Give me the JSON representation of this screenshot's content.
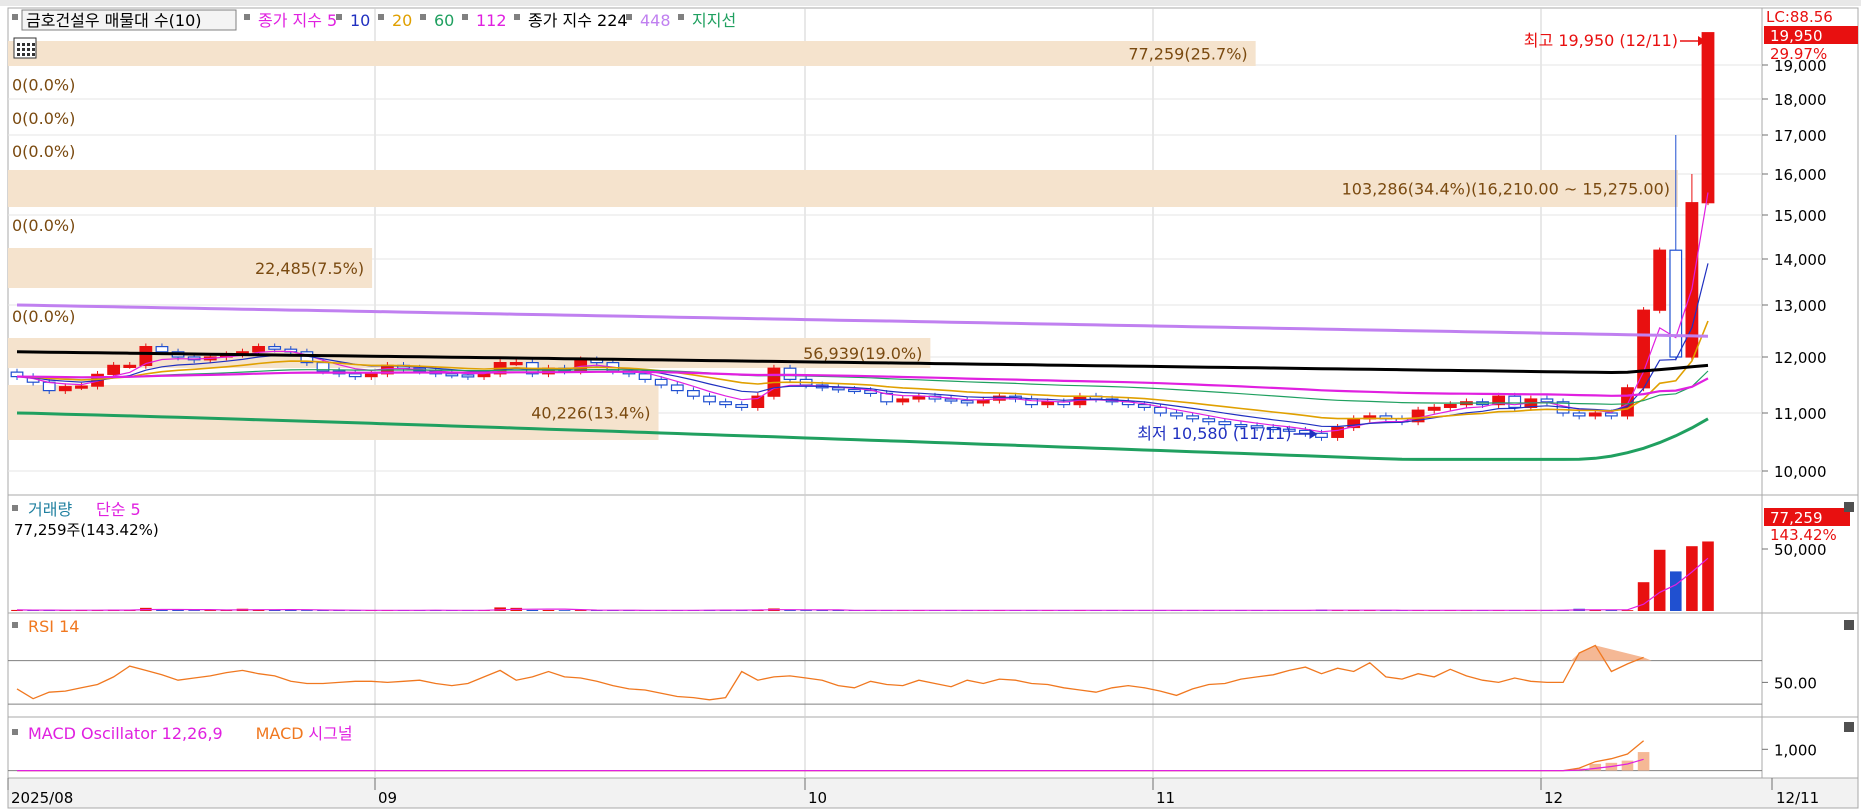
{
  "window": {
    "title": "금호건설우 매물대 수(10)"
  },
  "price_panel": {
    "legend": [
      {
        "text": "금호건설우 매물대 수(10)",
        "color": "#000000",
        "boxed": true
      },
      {
        "text": "종가 지수 5",
        "color": "#e020e0"
      },
      {
        "text": "10",
        "color": "#2030c0"
      },
      {
        "text": "20",
        "color": "#e0a000"
      },
      {
        "text": "60",
        "color": "#20a060"
      },
      {
        "text": "112",
        "color": "#e020e0"
      },
      {
        "text": "종가 지수 224",
        "color": "#000000"
      },
      {
        "text": "448",
        "color": "#c080f0"
      },
      {
        "text": "지지선",
        "color": "#20a060"
      }
    ],
    "lc_label": "LC:88.56",
    "last_price_label": "19,950",
    "last_pct_label": "29.97%",
    "high_label": "최고 19,950 (12/11)",
    "low_label": "최저 10,580 (11/11)",
    "price_ticks": [
      "10,000",
      "11,000",
      "12,000",
      "13,000",
      "14,000",
      "15,000",
      "16,000",
      "17,000",
      "18,000",
      "19,000"
    ]
  },
  "volume_panel": {
    "legend": [
      {
        "text": "거래량",
        "color": "#2080a0"
      },
      {
        "text": "단순 5",
        "color": "#e020e0"
      }
    ],
    "value_label": "77,259주(143.42%)",
    "last_value_box": "77,259",
    "last_pct_box": "143.42%",
    "ticks": [
      "50,000"
    ]
  },
  "rsi_panel": {
    "legend": [
      {
        "text": "RSI 14",
        "color": "#f07820"
      }
    ],
    "ticks": [
      "50.00"
    ]
  },
  "macd_panel": {
    "legend": [
      {
        "text": "MACD Oscillator 12,26,9",
        "color": "#e020e0"
      },
      {
        "text": "MACD",
        "color": "#f07820"
      },
      {
        "text": "시그널",
        "color": "#e020e0"
      }
    ],
    "ticks": [
      "1,000"
    ]
  },
  "x_axis": {
    "labels": [
      "2025/08",
      "09",
      "10",
      "11",
      "12"
    ],
    "right_label": "12/11"
  },
  "colors": {
    "up": "#e81010",
    "down": "#2050d0",
    "vp": "#f5e3cd",
    "vp_text": "#7a4a10",
    "grid": "#d0d0d0"
  },
  "chart_data": [
    {
      "type": "candlestick",
      "ylim": [
        9700,
        20100
      ],
      "close": [
        11650,
        11550,
        11400,
        11470,
        11480,
        11690,
        11850,
        11850,
        12200,
        12100,
        12000,
        11950,
        12000,
        12050,
        12100,
        12200,
        12150,
        12100,
        11900,
        11750,
        11700,
        11650,
        11700,
        11850,
        11800,
        11750,
        11700,
        11680,
        11650,
        11700,
        11900,
        11900,
        11700,
        11800,
        11750,
        11950,
        11900,
        11750,
        11700,
        11600,
        11500,
        11400,
        11300,
        11200,
        11150,
        11100,
        11300,
        11800,
        11600,
        11500,
        11450,
        11420,
        11400,
        11350,
        11200,
        11250,
        11300,
        11250,
        11220,
        11180,
        11230,
        11300,
        11250,
        11150,
        11200,
        11150,
        11300,
        11250,
        11200,
        11150,
        11100,
        11000,
        10950,
        10900,
        10850,
        10800,
        10780,
        10750,
        10720,
        10700,
        10650,
        10580,
        10750,
        10900,
        10950,
        10900,
        10850,
        11050,
        11100,
        11150,
        11200,
        11150,
        11300,
        11100,
        11250,
        11200,
        11000,
        10950,
        11000,
        10950,
        11450,
        12900,
        14200,
        12000,
        15300,
        19950
      ],
      "volume_pct_labels": []
    },
    {
      "type": "volume_profile",
      "bands": [
        {
          "lo": 19600,
          "hi": 20100,
          "label": "77,259(25.7%)",
          "share": 0.257
        },
        {
          "lo": 19000,
          "hi": 19600,
          "label": "0(0.0%)",
          "share": 0
        },
        {
          "lo": 18300,
          "hi": 19000,
          "label": "0(0.0%)",
          "share": 0
        },
        {
          "lo": 17600,
          "hi": 18300,
          "label": "0(0.0%)",
          "share": 0
        },
        {
          "lo": 15275,
          "hi": 16210,
          "label": "103,286(34.4%)(16,210.00 ~ 15,275.00)",
          "share": 0.344
        },
        {
          "lo": 14500,
          "hi": 15275,
          "label": "0(0.0%)",
          "share": 0
        },
        {
          "lo": 13300,
          "hi": 14400,
          "label": "22,485(7.5%)",
          "share": 0.075
        },
        {
          "lo": 12700,
          "hi": 13300,
          "label": "0(0.0%)",
          "share": 0
        },
        {
          "lo": 11800,
          "hi": 12400,
          "label": "56,939(19.0%)",
          "share": 0.19
        },
        {
          "lo": 10600,
          "hi": 11700,
          "label": "40,226(13.4%)",
          "share": 0.134
        }
      ]
    },
    {
      "type": "line",
      "series": [
        {
          "key": "ema224",
          "color": "#000000",
          "width": 3,
          "values": [
            12100,
            11700,
            11850
          ]
        },
        {
          "key": "ema448",
          "color": "#c080f0",
          "width": 3,
          "values": [
            13000,
            12600,
            12400
          ]
        },
        {
          "key": "support",
          "color": "#20a060",
          "width": 3,
          "values": [
            11000,
            10200,
            10900
          ]
        }
      ]
    },
    {
      "type": "bar",
      "name": "거래량",
      "ylim": [
        0,
        90000
      ],
      "values": [
        1200,
        900,
        800,
        700,
        900,
        1100,
        1500,
        1000,
        3500,
        1200,
        1100,
        900,
        1000,
        1300,
        2500,
        1400,
        1200,
        1100,
        900,
        900,
        800,
        700,
        800,
        900,
        900,
        800,
        800,
        700,
        700,
        700,
        4000,
        3500,
        1200,
        1100,
        900,
        1000,
        900,
        800,
        700,
        700,
        900,
        700,
        800,
        1200,
        1300,
        1100,
        900,
        2800,
        1000,
        800,
        800,
        700,
        700,
        800,
        900,
        700,
        800,
        700,
        800,
        700,
        800,
        900,
        800,
        700,
        800,
        700,
        900,
        800,
        700,
        800,
        700,
        800,
        700,
        700,
        800,
        800,
        700,
        700,
        700,
        700,
        700,
        1500,
        900,
        800,
        800,
        700,
        700,
        900,
        800,
        800,
        800,
        700,
        900,
        900,
        800,
        700,
        1100,
        2500,
        1400,
        1000,
        900,
        32000,
        68000,
        44000,
        72000,
        77259
      ]
    },
    {
      "type": "line",
      "name": "RSI 14",
      "ylim": [
        20,
        100
      ],
      "values": [
        44,
        35,
        41,
        42,
        45,
        48,
        55,
        65,
        61,
        57,
        52,
        54,
        56,
        59,
        61,
        58,
        56,
        51,
        49,
        49,
        50,
        51,
        51,
        50,
        51,
        52,
        49,
        47,
        49,
        55,
        61,
        52,
        55,
        60,
        55,
        54,
        51,
        47,
        44,
        43,
        40,
        37,
        36,
        34,
        36,
        60,
        52,
        55,
        56,
        54,
        52,
        47,
        45,
        51,
        48,
        47,
        52,
        49,
        46,
        52,
        49,
        53,
        52,
        49,
        48,
        45,
        43,
        41,
        45,
        47,
        45,
        42,
        38,
        44,
        48,
        49,
        53,
        55,
        57,
        61,
        64,
        58,
        63,
        60,
        68,
        55,
        53,
        58,
        55,
        62,
        56,
        52,
        50,
        54,
        51,
        50,
        50,
        77,
        84,
        60,
        67,
        73
      ]
    },
    {
      "type": "line",
      "name": "MACD",
      "ylim": [
        -300,
        2000
      ],
      "values": [
        0,
        0,
        0,
        0,
        0,
        0,
        0,
        0,
        0,
        0,
        0,
        0,
        0,
        0,
        0,
        0,
        0,
        0,
        0,
        0,
        0,
        0,
        0,
        0,
        0,
        0,
        0,
        0,
        0,
        0,
        0,
        0,
        0,
        0,
        0,
        0,
        0,
        0,
        0,
        0,
        0,
        0,
        0,
        0,
        0,
        0,
        0,
        0,
        0,
        0,
        0,
        0,
        0,
        0,
        0,
        0,
        0,
        0,
        0,
        0,
        0,
        0,
        0,
        0,
        0,
        0,
        0,
        0,
        0,
        0,
        0,
        0,
        0,
        0,
        0,
        0,
        0,
        0,
        0,
        0,
        0,
        0,
        0,
        0,
        0,
        0,
        0,
        0,
        0,
        0,
        0,
        0,
        0,
        0,
        0,
        0,
        0,
        120,
        420,
        560,
        780,
        1400
      ]
    }
  ]
}
